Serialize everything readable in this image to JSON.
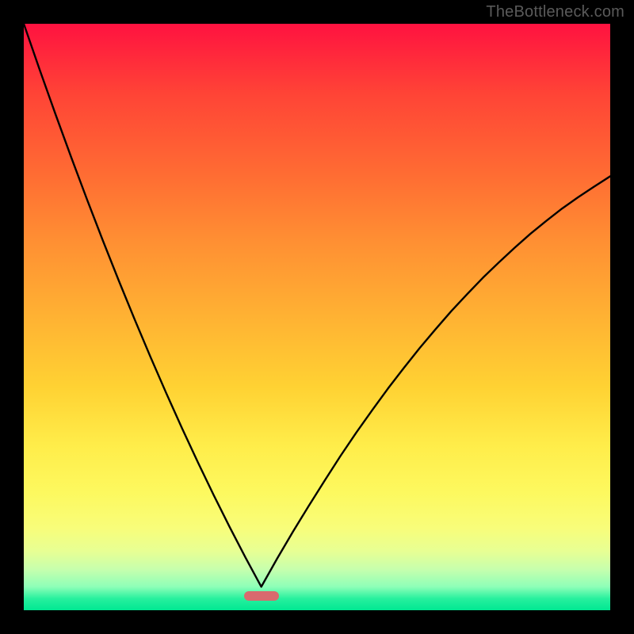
{
  "watermark": {
    "text": "TheBottleneck.com"
  },
  "chart_data": {
    "type": "line",
    "title": "",
    "xlabel": "",
    "ylabel": "",
    "xlim": [
      0,
      1
    ],
    "ylim": [
      0,
      1
    ],
    "curve_note": "V-shaped bottleneck curve; values are fractional positions read from the plot (x to the right, y downward from top of plot area).",
    "minimum_x": 0.405,
    "x": [
      0.0,
      0.027,
      0.054,
      0.081,
      0.108,
      0.135,
      0.162,
      0.189,
      0.216,
      0.243,
      0.27,
      0.297,
      0.324,
      0.351,
      0.378,
      0.405,
      0.432,
      0.459,
      0.486,
      0.513,
      0.54,
      0.567,
      0.594,
      0.621,
      0.648,
      0.675,
      0.702,
      0.729,
      0.756,
      0.783,
      0.81,
      0.837,
      0.864,
      0.891,
      0.918,
      0.945,
      0.972,
      1.0
    ],
    "y": [
      0.0,
      0.078,
      0.154,
      0.228,
      0.3,
      0.37,
      0.438,
      0.504,
      0.568,
      0.63,
      0.69,
      0.748,
      0.804,
      0.858,
      0.91,
      0.96,
      0.912,
      0.866,
      0.822,
      0.779,
      0.737,
      0.697,
      0.659,
      0.622,
      0.587,
      0.553,
      0.521,
      0.49,
      0.461,
      0.433,
      0.407,
      0.382,
      0.358,
      0.336,
      0.315,
      0.296,
      0.278,
      0.26
    ],
    "marker": {
      "x": 0.405,
      "y": 0.975,
      "shape": "pill",
      "color": "#d86a6e"
    },
    "background_gradient": {
      "top": "#ff1240",
      "mid": "#ffd233",
      "bottom": "#00e892"
    }
  }
}
